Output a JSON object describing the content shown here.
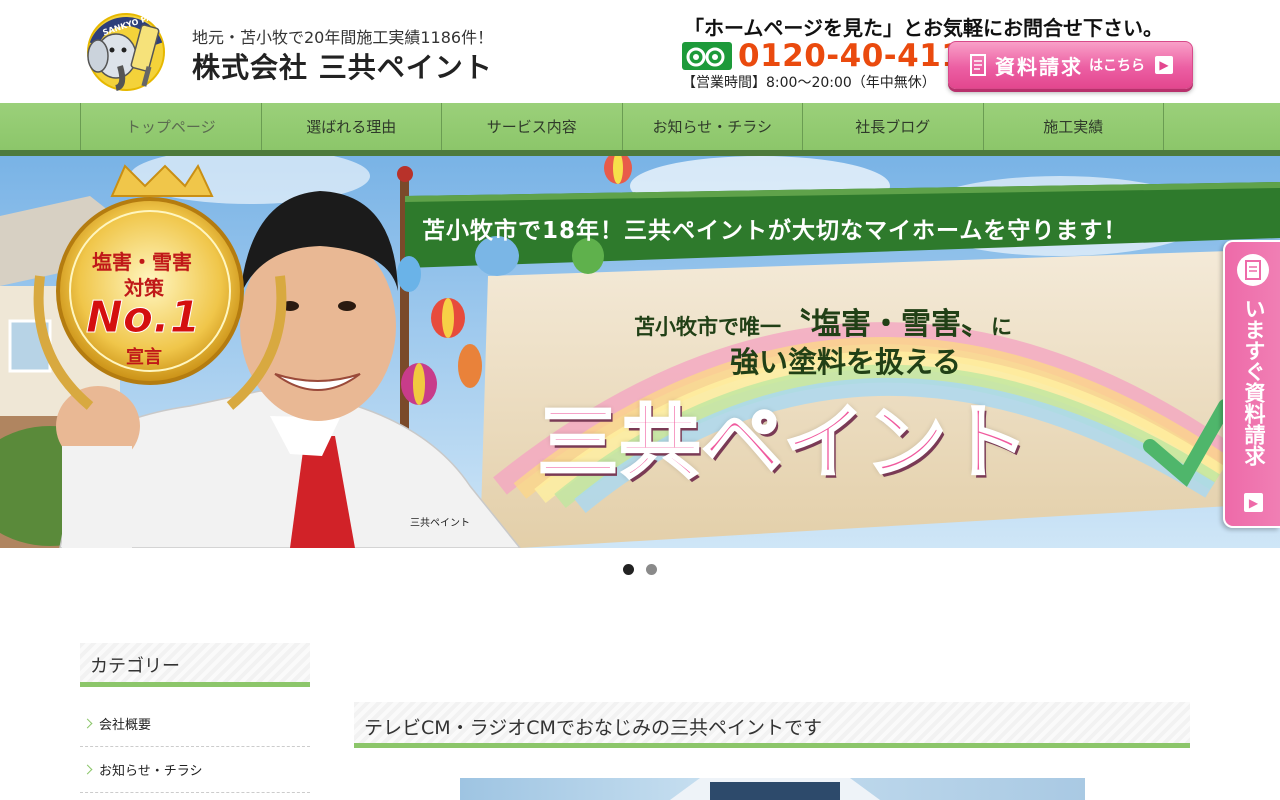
{
  "header": {
    "mascot_brand": "SANKYO PAINT",
    "tagline": "地元・苫小牧で20年間施工実績1186件！",
    "company": "株式会社 三共ペイント",
    "contact_lead": "「ホームページを見た」とお気軽にお問合せ下さい。",
    "phone": "0120-40-4116",
    "hours": "【営業時間】8:00〜20:00（年中無休）",
    "request_main": "資料請求",
    "request_sub": "はこちら"
  },
  "nav": {
    "items": [
      "トップページ",
      "選ばれる理由",
      "サービス内容",
      "お知らせ・チラシ",
      "社長ブログ",
      "施工実績"
    ]
  },
  "hero": {
    "banner": "苫小牧市で18年！三共ペイントが大切なマイホームを守ります！",
    "line1_pre": "苫小牧市で唯一",
    "line1_em": "〝塩害・雪害〟",
    "line1_post": "に",
    "line2": "強い塗料を扱える",
    "brand": "三共ペイント",
    "medal_l1": "塩害・雪害",
    "medal_l2": "対策",
    "medal_l3": "No.1",
    "medal_l4": "宣言",
    "uniform_badge": "三共ペイント"
  },
  "side_tab": {
    "label": "いますぐ資料請求"
  },
  "sidebar": {
    "title": "カテゴリー",
    "items": [
      "会社概要",
      "お知らせ・チラシ"
    ]
  },
  "main": {
    "title": "テレビCM・ラジオCMでおなじみの三共ペイントです"
  },
  "colors": {
    "accent_green": "#8cc66a",
    "phone_orange": "#ea4a0e",
    "pink": "#ec5fa3"
  }
}
